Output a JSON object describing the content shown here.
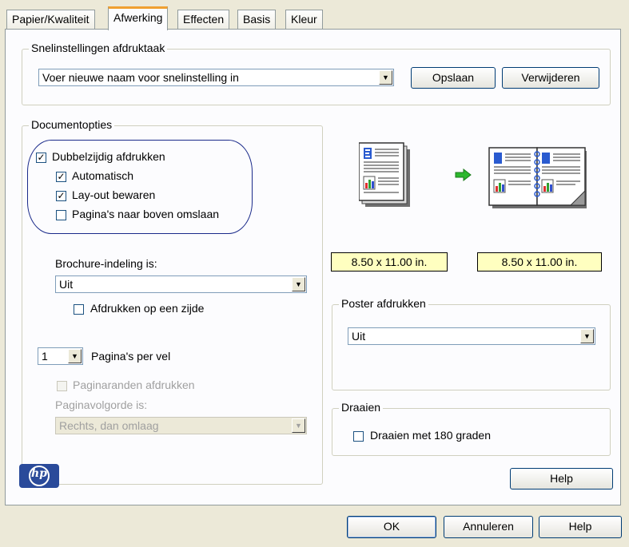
{
  "tabs": [
    {
      "label": "Papier/Kwaliteit"
    },
    {
      "label": "Afwerking"
    },
    {
      "label": "Effecten"
    },
    {
      "label": "Basis"
    },
    {
      "label": "Kleur"
    }
  ],
  "quickset": {
    "legend": "Snelinstellingen afdruktaak",
    "value": "Voer nieuwe naam voor snelinstelling in",
    "save_label": "Opslaan",
    "delete_label": "Verwijderen"
  },
  "docopts": {
    "legend": "Documentopties",
    "duplex_label": "Dubbelzijdig afdrukken",
    "duplex_checked": true,
    "auto_label": "Automatisch",
    "auto_checked": true,
    "keep_layout_label": "Lay-out bewaren",
    "keep_layout_checked": true,
    "flip_up_label": "Pagina's naar boven omslaan",
    "flip_up_checked": false,
    "brochure_label": "Brochure-indeling is:",
    "brochure_value": "Uit",
    "one_side_label": "Afdrukken op een zijde",
    "pages_per_sheet_value": "1",
    "pages_per_sheet_label": "Pagina's per vel",
    "page_borders_label": "Paginaranden afdrukken",
    "page_order_label": "Paginavolgorde is:",
    "page_order_value": "Rechts, dan omlaag"
  },
  "preview": {
    "size_left": "8.50 x 11.00 in.",
    "size_right": "8.50 x 11.00 in."
  },
  "poster": {
    "legend": "Poster afdrukken",
    "value": "Uit"
  },
  "rotate": {
    "legend": "Draaien",
    "rotate180_label": "Draaien met 180 graden"
  },
  "logo": {
    "text": "hp"
  },
  "panel_help_label": "Help",
  "footer": {
    "ok_label": "OK",
    "cancel_label": "Annuleren",
    "help_label": "Help"
  },
  "colors": {
    "accent_tab": "#f0a030",
    "highlight_oval": "#1a2a8a",
    "size_box": "#ffffc0",
    "hp_logo": "#2a4a9a",
    "arrow_green": "#2db82d"
  }
}
